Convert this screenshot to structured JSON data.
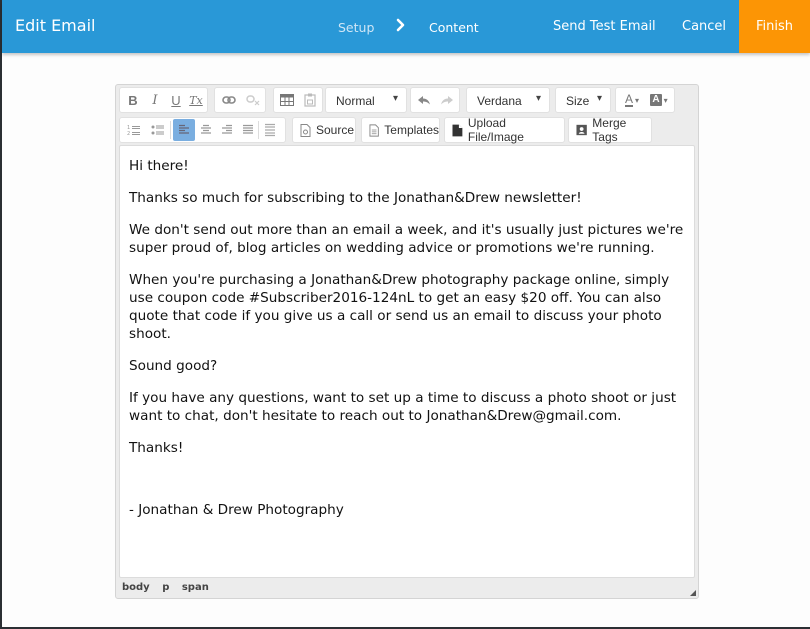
{
  "header": {
    "title": "Edit Email",
    "steps": [
      {
        "label": "Setup",
        "state": "inactive"
      },
      {
        "label": "Content",
        "state": "active"
      }
    ],
    "send_test_label": "Send Test Email",
    "cancel_label": "Cancel",
    "finish_label": "Finish",
    "colors": {
      "bar": "#2998d7",
      "finish": "#fc9505"
    }
  },
  "toolbar": {
    "row1": {
      "basic_styles": [
        {
          "icon": "bold-icon",
          "glyph": "B"
        },
        {
          "icon": "italic-icon",
          "glyph": "I"
        },
        {
          "icon": "underline-icon",
          "glyph": "U"
        },
        {
          "icon": "remove-format-icon",
          "glyph": "Tx"
        }
      ],
      "links": [
        {
          "icon": "link-icon",
          "enabled": true
        },
        {
          "icon": "unlink-icon",
          "enabled": false
        }
      ],
      "insert": [
        {
          "icon": "table-icon",
          "enabled": true
        },
        {
          "icon": "paste-icon",
          "enabled": false
        }
      ],
      "format_select": "Normal",
      "history": [
        {
          "icon": "undo-icon",
          "enabled": true
        },
        {
          "icon": "redo-icon",
          "enabled": false
        }
      ],
      "font_select": "Verdana",
      "size_select": "Size",
      "colors": [
        {
          "icon": "text-color-icon",
          "glyph": "A"
        },
        {
          "icon": "background-color-icon",
          "glyph": "A"
        }
      ]
    },
    "row2": {
      "lists": [
        {
          "icon": "numbered-list-icon"
        },
        {
          "icon": "bulleted-list-icon"
        }
      ],
      "align": [
        {
          "icon": "align-left-icon",
          "active": true
        },
        {
          "icon": "align-center-icon",
          "active": false
        },
        {
          "icon": "align-right-icon",
          "active": false
        },
        {
          "icon": "align-justify-icon",
          "active": false
        }
      ],
      "horizontal_rule": {
        "icon": "horizontal-rule-icon"
      },
      "source_label": "Source",
      "templates_label": "Templates",
      "upload_label": "Upload File/Image",
      "merge_tags_label": "Merge Tags"
    }
  },
  "content": {
    "paragraphs": [
      "Hi there!",
      "Thanks so much for subscribing to the Jonathan&Drew newsletter!",
      "We don't send out more than an email a week, and it's usually just pictures we're super proud of, blog articles on wedding advice or promotions we're running.",
      "When you're purchasing a Jonathan&Drew photography package online, simply use coupon code #Subscriber2016-124nL to get an easy $20 off. You can also quote that code if you give us a call or send us an email to discuss your photo shoot.",
      "Sound good?",
      "If you have any questions, want to set up a time to discuss a photo shoot or just want to chat, don't hesitate to reach out to Jonathan&Drew@gmail.com.",
      "Thanks!",
      "- Jonathan & Drew Photography"
    ]
  },
  "statusbar": {
    "path": [
      "body",
      "p",
      "span"
    ]
  }
}
